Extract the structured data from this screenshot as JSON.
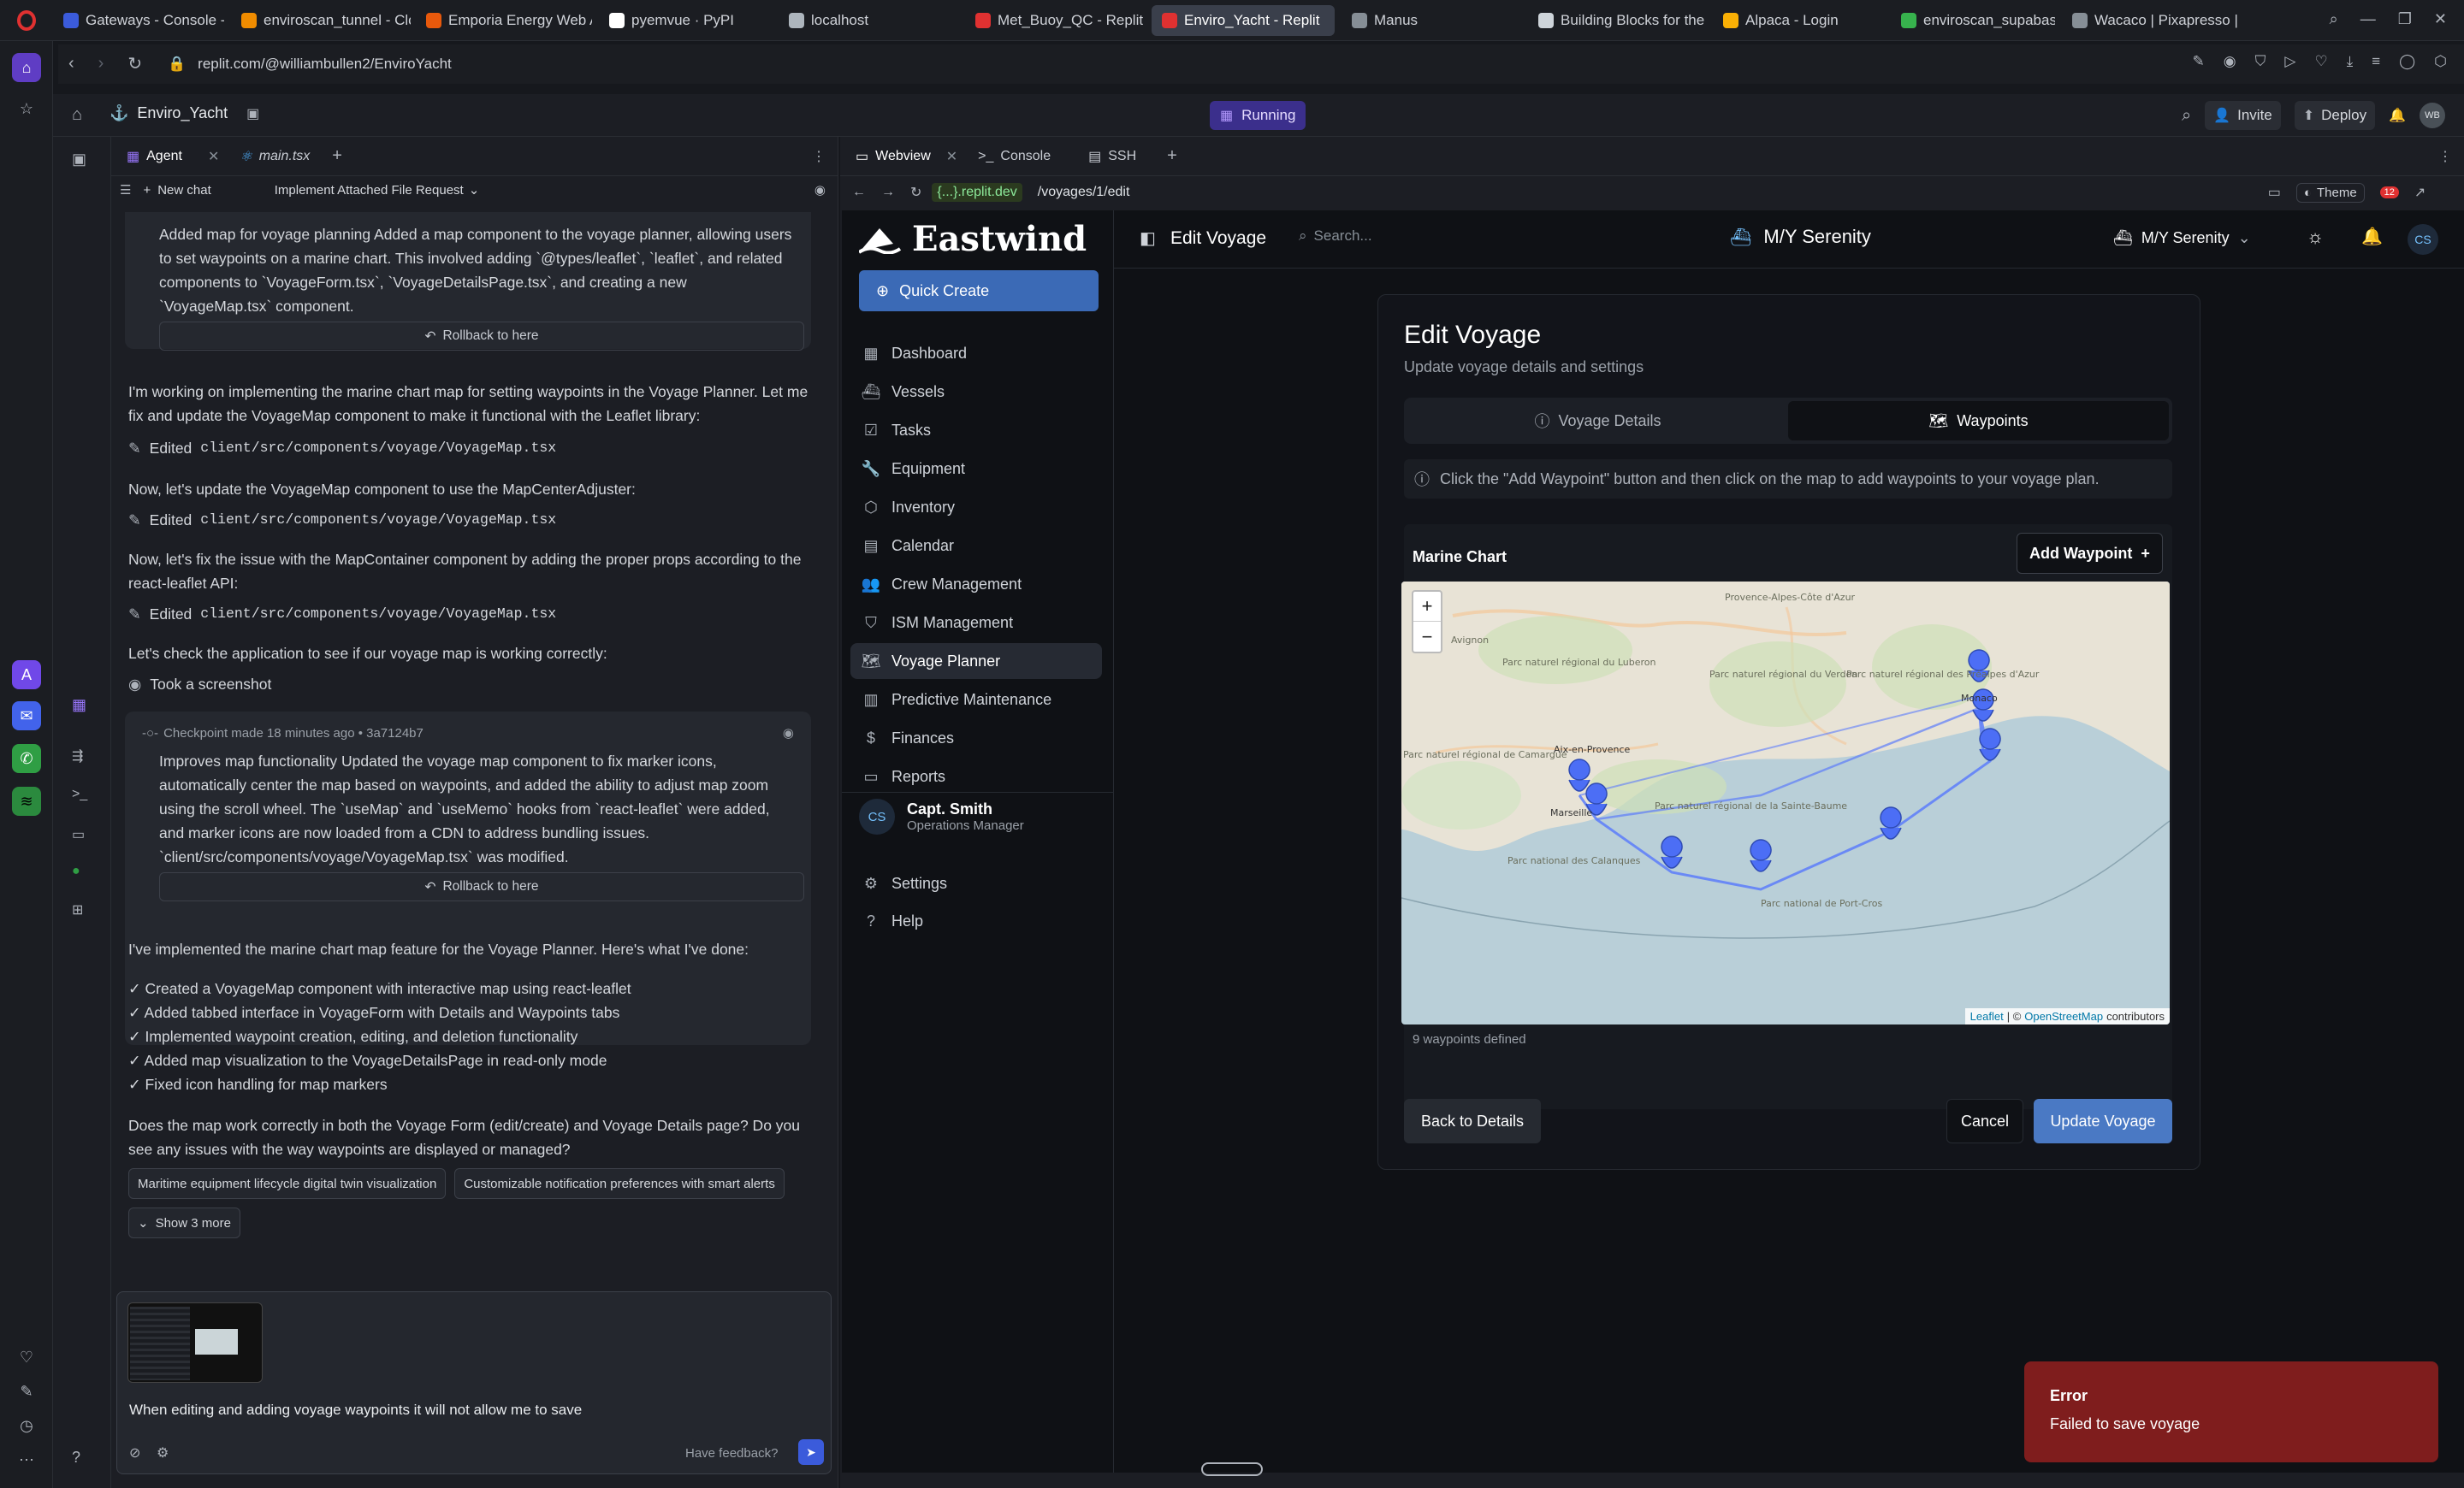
{
  "browser": {
    "tabs": [
      {
        "label": "Gateways - Console - The",
        "color": "#3b5bdb"
      },
      {
        "label": "enviroscan_tunnel - Clou",
        "color": "#f08c00"
      },
      {
        "label": "Emporia Energy Web App",
        "color": "#e8590c"
      },
      {
        "label": "pyemvue · PyPI",
        "color": "#ffffff"
      },
      {
        "label": "localhost",
        "color": "#adb5bd"
      },
      {
        "label": "Met_Buoy_QC - Replit",
        "color": "#e03131"
      },
      {
        "label": "Enviro_Yacht - Replit",
        "color": "#e03131"
      },
      {
        "label": "Manus",
        "color": "#868e96"
      },
      {
        "label": "Building Blocks for the W",
        "color": "#ced4da"
      },
      {
        "label": "Alpaca - Login",
        "color": "#fab005"
      },
      {
        "label": "enviroscan_supabase | E",
        "color": "#37b24d"
      },
      {
        "label": "Wacaco | Pixapresso | Ele",
        "color": "#868e96"
      }
    ],
    "url": "replit.com/@williambullen2/EnviroYacht"
  },
  "replit": {
    "project_name": "Enviro_Yacht",
    "run_status": "Running",
    "invite_label": "Invite",
    "deploy_label": "Deploy",
    "avatar_initials": "WB",
    "left_tabs": [
      {
        "label": "Agent"
      },
      {
        "label": "main.tsx"
      }
    ],
    "right_tabs": [
      {
        "label": "Webview"
      },
      {
        "label": "Console"
      },
      {
        "label": "SSH"
      }
    ],
    "new_chat_label": "New chat",
    "chat_title": "Implement Attached File Request",
    "webview_host": "{...}.replit.dev",
    "webview_path": "/voyages/1/edit",
    "theme_label": "Theme",
    "notif_count": "12"
  },
  "agent": {
    "checkpoint1": {
      "text": "Added map for voyage planning Added a map component to the voyage planner, allowing users to set waypoints on a marine chart. This involved adding `@types/leaflet`, `leaflet`, and related components to `VoyageForm.tsx`, `VoyageDetailsPage.tsx`, and creating a new `VoyageMap.tsx` component.",
      "rollback": "Rollback to here"
    },
    "msg1": "I'm working on implementing the marine chart map for setting waypoints in the Voyage Planner. Let me fix and update the VoyageMap component to make it functional with the Leaflet library:",
    "edit_label": "Edited",
    "edit_path": "client/src/components/voyage/VoyageMap.tsx",
    "msg2": "Now, let's update the VoyageMap component to use the MapCenterAdjuster:",
    "msg3": "Now, let's fix the issue with the MapContainer component by adding the proper props according to the react-leaflet API:",
    "msg4": "Let's check the application to see if our voyage map is working correctly:",
    "screenshot_label": "Took a screenshot",
    "checkpoint2": {
      "header": "Checkpoint made 18 minutes ago • 3a7124b7",
      "text": "Improves map functionality Updated the voyage map component to fix marker icons, automatically center the map based on waypoints, and added the ability to adjust map zoom using the scroll wheel. The `useMap` and `useMemo` hooks from `react-leaflet` were added, and marker icons are now loaded from a CDN to address bundling issues. `client/src/components/voyage/VoyageMap.tsx` was modified.",
      "rollback": "Rollback to here"
    },
    "summary_intro": "I've implemented the marine chart map feature for the Voyage Planner. Here's what I've done:",
    "summary_items": [
      "✓ Created a VoyageMap component with interactive map using react-leaflet",
      "✓ Added tabbed interface in VoyageForm with Details and Waypoints tabs",
      "✓ Implemented waypoint creation, editing, and deletion functionality",
      "✓ Added map visualization to the VoyageDetailsPage in read-only mode",
      "✓ Fixed icon handling for map markers"
    ],
    "question": "Does the map work correctly in both the Voyage Form (edit/create) and Voyage Details page? Do you see any issues with the way waypoints are displayed or managed?",
    "suggestions": [
      "Maritime equipment lifecycle digital twin visualization",
      "Customizable notification preferences with smart alerts"
    ],
    "show_more": "Show 3 more",
    "input_text": "When editing and adding voyage waypoints it will not allow me to save",
    "feedback_label": "Have feedback?"
  },
  "app": {
    "brand": "Eastwind",
    "quick_create": "Quick Create",
    "nav": [
      {
        "label": "Dashboard",
        "icon": "dashboard-icon",
        "glyph": "▦"
      },
      {
        "label": "Vessels",
        "icon": "ship-icon",
        "glyph": "⛴"
      },
      {
        "label": "Tasks",
        "icon": "checkbox-icon",
        "glyph": "☑"
      },
      {
        "label": "Equipment",
        "icon": "wrench-icon",
        "glyph": "🔧"
      },
      {
        "label": "Inventory",
        "icon": "boxes-icon",
        "glyph": "⬡"
      },
      {
        "label": "Calendar",
        "icon": "calendar-icon",
        "glyph": "▤"
      },
      {
        "label": "Crew Management",
        "icon": "users-icon",
        "glyph": "👥"
      },
      {
        "label": "ISM Management",
        "icon": "shield-icon",
        "glyph": "⛉"
      },
      {
        "label": "Voyage Planner",
        "icon": "map-icon",
        "glyph": "🗺"
      },
      {
        "label": "Predictive Maintenance",
        "icon": "chart-icon",
        "glyph": "▥"
      },
      {
        "label": "Finances",
        "icon": "dollar-icon",
        "glyph": "$"
      },
      {
        "label": "Reports",
        "icon": "file-icon",
        "glyph": "▭"
      }
    ],
    "active_nav": 8,
    "user": {
      "initials": "CS",
      "name": "Capt. Smith",
      "role": "Operations Manager"
    },
    "settings": "Settings",
    "help": "Help",
    "header_title": "Edit Voyage",
    "search_placeholder": "Search...",
    "vessel_title": "M/Y Serenity",
    "vessel_select": "M/Y Serenity",
    "header_avatar": "CS"
  },
  "form": {
    "title": "Edit Voyage",
    "subtitle": "Update voyage details and settings",
    "tabs": [
      {
        "label": "Voyage Details"
      },
      {
        "label": "Waypoints"
      }
    ],
    "active_tab": 1,
    "info": "Click the \"Add Waypoint\" button and then click on the map to add waypoints to your voyage plan.",
    "chart_title": "Marine Chart",
    "add_waypoint": "Add Waypoint",
    "waypoint_count": "9 waypoints defined",
    "back": "Back to Details",
    "cancel": "Cancel",
    "update": "Update Voyage"
  },
  "map": {
    "attribution_leaflet": "Leaflet",
    "attribution_osm": "OpenStreetMap",
    "attribution_suffix": "contributors",
    "labels": [
      "Provence-Alpes-Côte d'Azur",
      "Avignon",
      "Parc naturel régional du Luberon",
      "Parc naturel régional du Verdon",
      "Parc naturel régional des Préalpes d'Azur",
      "Aix-en-Provence",
      "Marseille",
      "Parc naturel régional de la Sainte-Baume",
      "Monaco",
      "Parc naturel régional de Camargue",
      "Parc national des Calanques",
      "Parc national de Port-Cros"
    ]
  },
  "toast": {
    "title": "Error",
    "message": "Failed to save voyage"
  }
}
